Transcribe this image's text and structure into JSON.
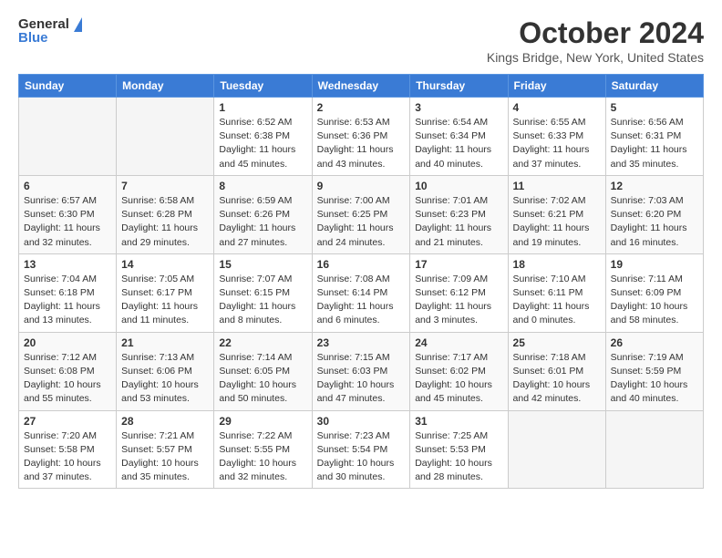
{
  "header": {
    "logo_general": "General",
    "logo_blue": "Blue",
    "month_title": "October 2024",
    "location": "Kings Bridge, New York, United States"
  },
  "weekdays": [
    "Sunday",
    "Monday",
    "Tuesday",
    "Wednesday",
    "Thursday",
    "Friday",
    "Saturday"
  ],
  "weeks": [
    [
      {
        "day": "",
        "info": ""
      },
      {
        "day": "",
        "info": ""
      },
      {
        "day": "1",
        "info": "Sunrise: 6:52 AM\nSunset: 6:38 PM\nDaylight: 11 hours and 45 minutes."
      },
      {
        "day": "2",
        "info": "Sunrise: 6:53 AM\nSunset: 6:36 PM\nDaylight: 11 hours and 43 minutes."
      },
      {
        "day": "3",
        "info": "Sunrise: 6:54 AM\nSunset: 6:34 PM\nDaylight: 11 hours and 40 minutes."
      },
      {
        "day": "4",
        "info": "Sunrise: 6:55 AM\nSunset: 6:33 PM\nDaylight: 11 hours and 37 minutes."
      },
      {
        "day": "5",
        "info": "Sunrise: 6:56 AM\nSunset: 6:31 PM\nDaylight: 11 hours and 35 minutes."
      }
    ],
    [
      {
        "day": "6",
        "info": "Sunrise: 6:57 AM\nSunset: 6:30 PM\nDaylight: 11 hours and 32 minutes."
      },
      {
        "day": "7",
        "info": "Sunrise: 6:58 AM\nSunset: 6:28 PM\nDaylight: 11 hours and 29 minutes."
      },
      {
        "day": "8",
        "info": "Sunrise: 6:59 AM\nSunset: 6:26 PM\nDaylight: 11 hours and 27 minutes."
      },
      {
        "day": "9",
        "info": "Sunrise: 7:00 AM\nSunset: 6:25 PM\nDaylight: 11 hours and 24 minutes."
      },
      {
        "day": "10",
        "info": "Sunrise: 7:01 AM\nSunset: 6:23 PM\nDaylight: 11 hours and 21 minutes."
      },
      {
        "day": "11",
        "info": "Sunrise: 7:02 AM\nSunset: 6:21 PM\nDaylight: 11 hours and 19 minutes."
      },
      {
        "day": "12",
        "info": "Sunrise: 7:03 AM\nSunset: 6:20 PM\nDaylight: 11 hours and 16 minutes."
      }
    ],
    [
      {
        "day": "13",
        "info": "Sunrise: 7:04 AM\nSunset: 6:18 PM\nDaylight: 11 hours and 13 minutes."
      },
      {
        "day": "14",
        "info": "Sunrise: 7:05 AM\nSunset: 6:17 PM\nDaylight: 11 hours and 11 minutes."
      },
      {
        "day": "15",
        "info": "Sunrise: 7:07 AM\nSunset: 6:15 PM\nDaylight: 11 hours and 8 minutes."
      },
      {
        "day": "16",
        "info": "Sunrise: 7:08 AM\nSunset: 6:14 PM\nDaylight: 11 hours and 6 minutes."
      },
      {
        "day": "17",
        "info": "Sunrise: 7:09 AM\nSunset: 6:12 PM\nDaylight: 11 hours and 3 minutes."
      },
      {
        "day": "18",
        "info": "Sunrise: 7:10 AM\nSunset: 6:11 PM\nDaylight: 11 hours and 0 minutes."
      },
      {
        "day": "19",
        "info": "Sunrise: 7:11 AM\nSunset: 6:09 PM\nDaylight: 10 hours and 58 minutes."
      }
    ],
    [
      {
        "day": "20",
        "info": "Sunrise: 7:12 AM\nSunset: 6:08 PM\nDaylight: 10 hours and 55 minutes."
      },
      {
        "day": "21",
        "info": "Sunrise: 7:13 AM\nSunset: 6:06 PM\nDaylight: 10 hours and 53 minutes."
      },
      {
        "day": "22",
        "info": "Sunrise: 7:14 AM\nSunset: 6:05 PM\nDaylight: 10 hours and 50 minutes."
      },
      {
        "day": "23",
        "info": "Sunrise: 7:15 AM\nSunset: 6:03 PM\nDaylight: 10 hours and 47 minutes."
      },
      {
        "day": "24",
        "info": "Sunrise: 7:17 AM\nSunset: 6:02 PM\nDaylight: 10 hours and 45 minutes."
      },
      {
        "day": "25",
        "info": "Sunrise: 7:18 AM\nSunset: 6:01 PM\nDaylight: 10 hours and 42 minutes."
      },
      {
        "day": "26",
        "info": "Sunrise: 7:19 AM\nSunset: 5:59 PM\nDaylight: 10 hours and 40 minutes."
      }
    ],
    [
      {
        "day": "27",
        "info": "Sunrise: 7:20 AM\nSunset: 5:58 PM\nDaylight: 10 hours and 37 minutes."
      },
      {
        "day": "28",
        "info": "Sunrise: 7:21 AM\nSunset: 5:57 PM\nDaylight: 10 hours and 35 minutes."
      },
      {
        "day": "29",
        "info": "Sunrise: 7:22 AM\nSunset: 5:55 PM\nDaylight: 10 hours and 32 minutes."
      },
      {
        "day": "30",
        "info": "Sunrise: 7:23 AM\nSunset: 5:54 PM\nDaylight: 10 hours and 30 minutes."
      },
      {
        "day": "31",
        "info": "Sunrise: 7:25 AM\nSunset: 5:53 PM\nDaylight: 10 hours and 28 minutes."
      },
      {
        "day": "",
        "info": ""
      },
      {
        "day": "",
        "info": ""
      }
    ]
  ]
}
